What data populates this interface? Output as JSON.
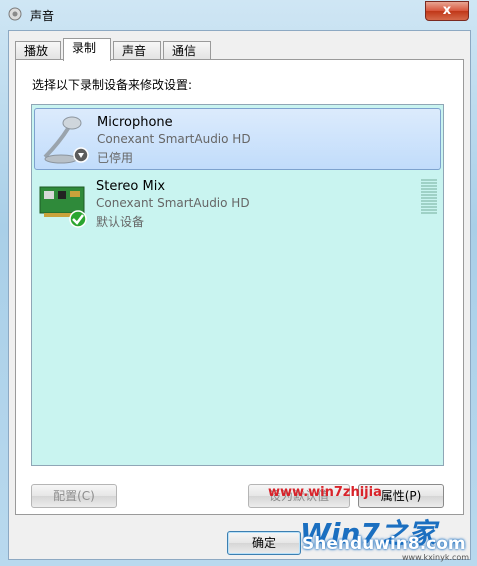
{
  "window": {
    "title": "声音",
    "close_glyph": "x"
  },
  "tabs": [
    "播放",
    "录制",
    "声音",
    "通信"
  ],
  "active_tab": 1,
  "instruction": "选择以下录制设备来修改设置:",
  "devices": [
    {
      "name": "Microphone",
      "driver": "Conexant SmartAudio HD",
      "status": "已停用",
      "icon": "microphone-icon",
      "badge": "disabled-arrow-badge"
    },
    {
      "name": "Stereo Mix",
      "driver": "Conexant SmartAudio HD",
      "status": "默认设备",
      "icon": "sound-card-icon",
      "badge": "green-check-badge"
    }
  ],
  "buttons": {
    "configure": "配置(C)",
    "set_default": "设为默认值",
    "properties": "属性(P)",
    "ok": "确定"
  },
  "watermark": {
    "url": "www.win7zhijia",
    "logo": "Win7之家",
    "site": "Shenduwin8.com",
    "sub": "www.kxinyk.com"
  },
  "colors": {
    "list_bg": "#c9f4f0",
    "selection": "#c1dcfb",
    "watermark_red": "#d9232a",
    "watermark_blue": "#1b6fc0"
  }
}
